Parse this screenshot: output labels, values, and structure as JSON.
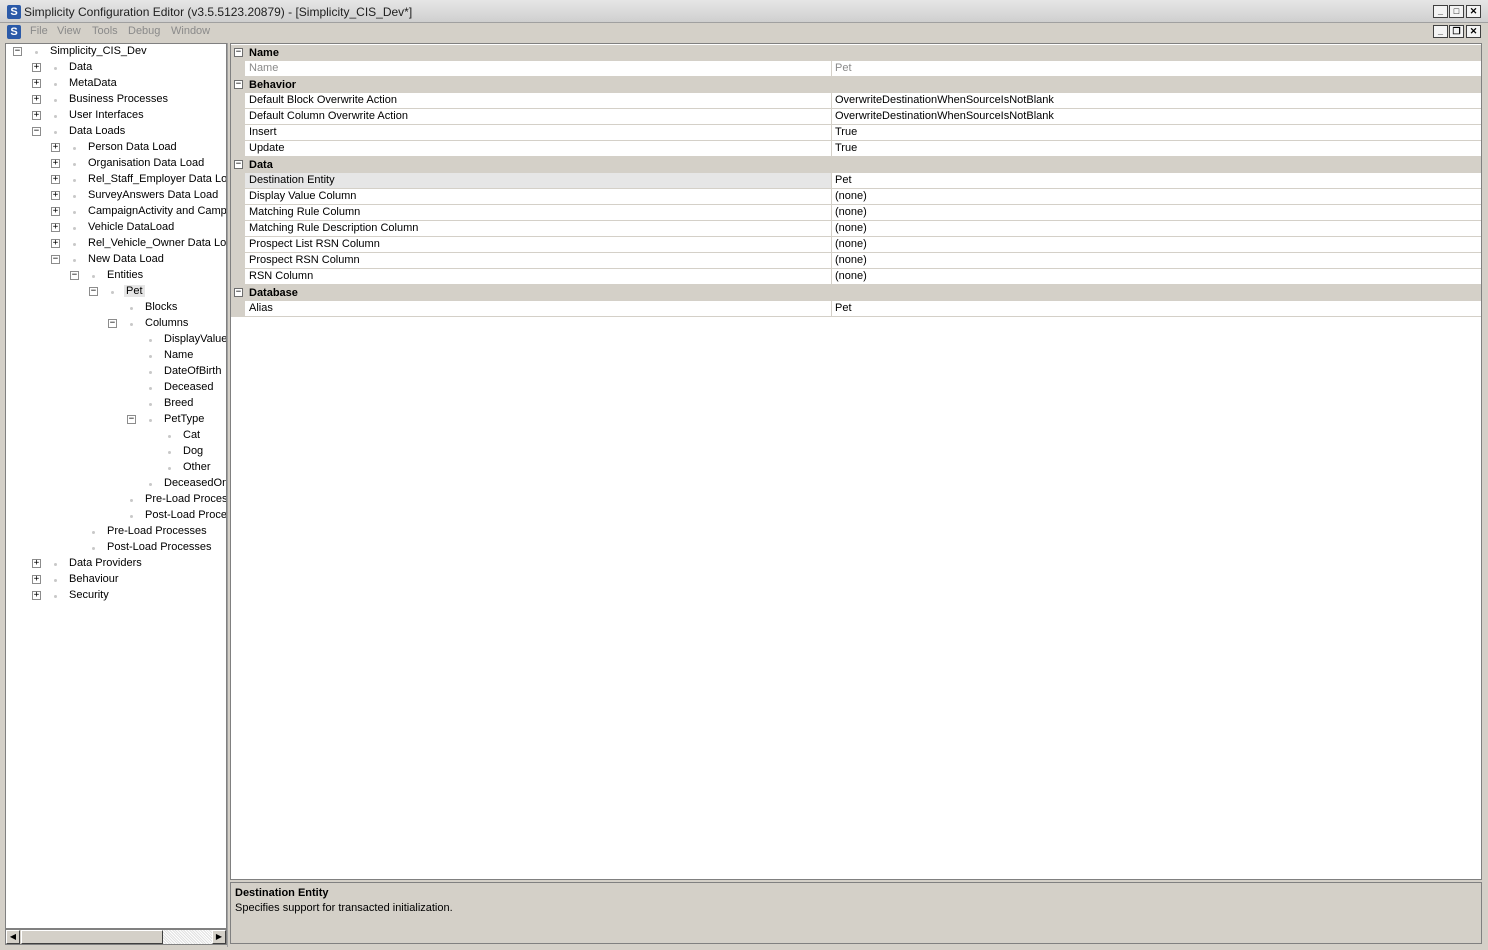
{
  "window": {
    "app_icon": "S",
    "title": "Simplicity Configuration Editor (v3.5.5123.20879) - [Simplicity_CIS_Dev*]",
    "minimize": "_",
    "maximize": "□",
    "close": "✕",
    "restore": "❐"
  },
  "menu": {
    "items": [
      {
        "label": "File"
      },
      {
        "label": "View"
      },
      {
        "label": "Tools"
      },
      {
        "label": "Debug"
      },
      {
        "label": "Window"
      }
    ]
  },
  "tree": {
    "nodes": [
      {
        "label": "Simplicity_CIS_Dev",
        "toggle": "−"
      },
      {
        "label": "Data",
        "toggle": "+"
      },
      {
        "label": "MetaData",
        "toggle": "+"
      },
      {
        "label": "Business Processes",
        "toggle": "+"
      },
      {
        "label": "User Interfaces",
        "toggle": "+"
      },
      {
        "label": "Data Loads",
        "toggle": "−"
      },
      {
        "label": "Person Data Load",
        "toggle": "+"
      },
      {
        "label": "Organisation Data Load",
        "toggle": "+"
      },
      {
        "label": "Rel_Staff_Employer Data Load",
        "toggle": "+"
      },
      {
        "label": "SurveyAnswers Data Load",
        "toggle": "+"
      },
      {
        "label": "CampaignActivity and Campaign Data Load",
        "toggle": "+"
      },
      {
        "label": "Vehicle DataLoad",
        "toggle": "+"
      },
      {
        "label": "Rel_Vehicle_Owner Data Load",
        "toggle": "+"
      },
      {
        "label": "New Data Load",
        "toggle": "−"
      },
      {
        "label": "Entities",
        "toggle": "−"
      },
      {
        "label": "Pet",
        "toggle": "−"
      },
      {
        "label": "Blocks",
        "toggle": ""
      },
      {
        "label": "Columns",
        "toggle": "−"
      },
      {
        "label": "DisplayValue",
        "toggle": ""
      },
      {
        "label": "Name",
        "toggle": ""
      },
      {
        "label": "DateOfBirth",
        "toggle": ""
      },
      {
        "label": "Deceased",
        "toggle": ""
      },
      {
        "label": "Breed",
        "toggle": ""
      },
      {
        "label": "PetType",
        "toggle": "−"
      },
      {
        "label": "Cat",
        "toggle": ""
      },
      {
        "label": "Dog",
        "toggle": ""
      },
      {
        "label": "Other",
        "toggle": ""
      },
      {
        "label": "DeceasedOn",
        "toggle": ""
      },
      {
        "label": "Pre-Load Processes",
        "toggle": ""
      },
      {
        "label": "Post-Load Processes",
        "toggle": ""
      },
      {
        "label": "Pre-Load Processes",
        "toggle": ""
      },
      {
        "label": "Post-Load Processes",
        "toggle": ""
      },
      {
        "label": "Data Providers",
        "toggle": "+"
      },
      {
        "label": "Behaviour",
        "toggle": "+"
      },
      {
        "label": "Security",
        "toggle": "+"
      }
    ]
  },
  "scrollbar": {
    "left_arrow": "◀",
    "right_arrow": "▶"
  },
  "grid": {
    "categories": [
      {
        "label": "Name",
        "toggle": "−"
      },
      {
        "label": "Behavior",
        "toggle": "−"
      },
      {
        "label": "Data",
        "toggle": "−"
      },
      {
        "label": "Database",
        "toggle": "−"
      }
    ],
    "properties": [
      {
        "name": "Name",
        "value": "Pet"
      },
      {
        "name": "Default Block Overwrite Action",
        "value": "OverwriteDestinationWhenSourceIsNotBlank"
      },
      {
        "name": "Default Column Overwrite Action",
        "value": "OverwriteDestinationWhenSourceIsNotBlank"
      },
      {
        "name": "Insert",
        "value": "True"
      },
      {
        "name": "Update",
        "value": "True"
      },
      {
        "name": "Destination Entity",
        "value": "Pet"
      },
      {
        "name": "Display Value Column",
        "value": "(none)"
      },
      {
        "name": "Matching Rule Column",
        "value": "(none)"
      },
      {
        "name": "Matching Rule Description Column",
        "value": "(none)"
      },
      {
        "name": "Prospect List RSN Column",
        "value": "(none)"
      },
      {
        "name": "Prospect RSN Column",
        "value": "(none)"
      },
      {
        "name": "RSN Column",
        "value": "(none)"
      },
      {
        "name": "Alias",
        "value": "Pet"
      }
    ]
  },
  "help": {
    "title": "Destination Entity",
    "description": "Specifies support for transacted initialization."
  }
}
